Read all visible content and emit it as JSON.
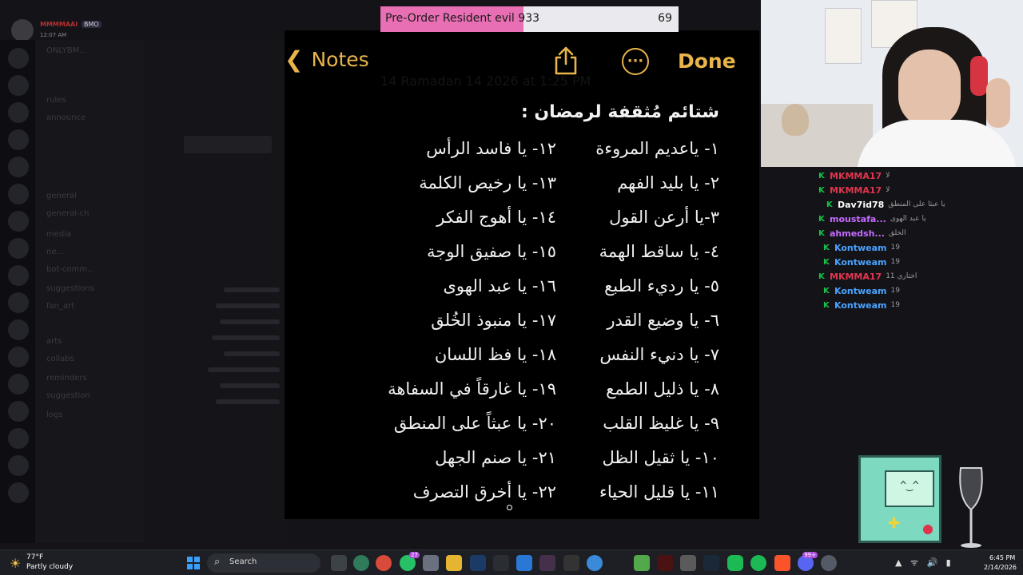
{
  "discord": {
    "user": {
      "name": "MMMMAAI",
      "badge": "BMO",
      "time": "12:07 AM"
    },
    "channels": [
      "ONLYBM...",
      "rules",
      "announce",
      "general",
      "general-ch",
      "media",
      "ne...",
      "bot-comm...",
      "suggestions",
      "fan_art",
      "arts",
      "collabs",
      "reminders",
      "suggestion",
      "logs"
    ]
  },
  "notes": {
    "back_label": "Notes",
    "done_label": "Done",
    "date_text": "14 Ramadan 14 2026 at 1:25 PM",
    "title": "شتائم مُثقفة لرمضان :",
    "items_right": [
      "١- ياعديم المروءة",
      "٢- يا بليد الفهم",
      "٣-يا أرعن القول",
      "٤- يا ساقط الهمة",
      "٥- يا رديء الطبع",
      "٦- يا وضيع القدر",
      "٧- يا دنيء النفس",
      "٨- يا ذليل الطمع",
      "٩- يا غليظ القلب",
      "١٠- يا ثقيل الظل",
      "١١- يا قليل الحياء"
    ],
    "items_left": [
      "١٢- يا فاسد الرأس",
      "١٣- يا رخيص الكلمة",
      "١٤- يا أهوج الفكر",
      "١٥- يا صفيق الوجة",
      "١٦- يا عبد الهوى",
      "١٧- يا منبوذ الخُلق",
      "١٨- يا فظ اللسان",
      "١٩- يا غارقاً في السفاهة",
      "٢٠- يا عبثاً على المنطق",
      "٢١- يا صنم الجهل",
      "٢٢- يا أخرق التصرف"
    ]
  },
  "poll": {
    "label": "Pre-Order Resident evil 9",
    "count": "33",
    "total": "69",
    "fill_fraction": 0.48
  },
  "chat": {
    "messages": [
      {
        "user": "MKMMA17",
        "color": "#e0364d",
        "text": "لا"
      },
      {
        "user": "MKMMA17",
        "color": "#e0364d",
        "text": "لا"
      },
      {
        "user": "Dav7id78",
        "color": "#ffffff",
        "text": "يا عبثا على المنطق"
      },
      {
        "user": "moustafa...",
        "color": "#c56bff",
        "text": "يا عبد الهوى"
      },
      {
        "user": "ahmedsh...",
        "color": "#c56bff",
        "text": "الخلق"
      },
      {
        "user": "Kontweam",
        "color": "#4aa3ff",
        "text": "19"
      },
      {
        "user": "Kontweam",
        "color": "#4aa3ff",
        "text": "19"
      },
      {
        "user": "MKMMA17",
        "color": "#e0364d",
        "text": "اختاري 11"
      },
      {
        "user": "Kontweam",
        "color": "#4aa3ff",
        "text": "19"
      },
      {
        "user": "Kontweam",
        "color": "#4aa3ff",
        "text": "19"
      }
    ]
  },
  "taskbar": {
    "weather_temp": "77°F",
    "weather_desc": "Partly cloudy",
    "search_label": "Search",
    "whatsapp_badge": "27",
    "discord_badge": "99+",
    "time": "6:45 PM",
    "date": "2/14/2026"
  },
  "colors": {
    "accent": "#e8b54a",
    "poll_fill": "#e86fb4",
    "twitch_badge": "#19c34b"
  }
}
